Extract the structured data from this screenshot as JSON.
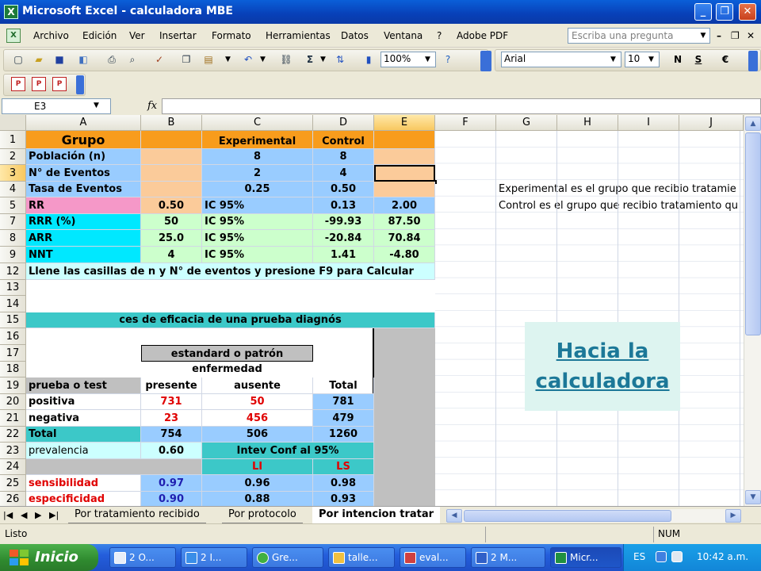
{
  "window": {
    "title": "Microsoft Excel - calculadora MBE",
    "minimize": "_",
    "maximize": "❐",
    "close": "✕"
  },
  "menu": {
    "items": [
      "Archivo",
      "Edición",
      "Ver",
      "Insertar",
      "Formato",
      "Herramientas",
      "Datos",
      "Ventana",
      "?",
      "Adobe PDF"
    ],
    "help_placeholder": "Escriba una pregunta",
    "mdi_minimize": "–",
    "mdi_restore": "❐",
    "mdi_close": "✕"
  },
  "toolbar": {
    "zoom": "100%",
    "font": "Arial",
    "font_size": "10",
    "bold": "N",
    "underline": "S",
    "currency": "€",
    "sum": "Σ"
  },
  "formula_bar": {
    "name_box": "E3",
    "fx": "fx",
    "content": ""
  },
  "columns": [
    "A",
    "B",
    "C",
    "D",
    "E",
    "F",
    "G",
    "H",
    "I",
    "J"
  ],
  "selected_column": "E",
  "rows": [
    "1",
    "2",
    "3",
    "4",
    "5",
    "7",
    "8",
    "9",
    "12",
    "13",
    "14",
    "15",
    "16",
    "17",
    "18",
    "19",
    "20",
    "21",
    "22",
    "23",
    "24",
    "25",
    "26"
  ],
  "selected_row": "3",
  "cells": {
    "r1": {
      "a": "Grupo",
      "c": "Experimental",
      "d": "Control"
    },
    "r2": {
      "a": "Población (n)",
      "c": "8",
      "d": "8"
    },
    "r3": {
      "a": "N° de Eventos",
      "c": "2",
      "d": "4"
    },
    "r4": {
      "a": "Tasa de Eventos",
      "c": "0.25",
      "d": "0.50"
    },
    "r5": {
      "a": "RR",
      "b": "0.50",
      "c": "IC 95%",
      "d": "0.13",
      "e": "2.00"
    },
    "r5_note": "Experimental es el grupo que recibio tratamie",
    "r7": {
      "a": "RRR (%)",
      "b": "50",
      "c": "IC 95%",
      "d": "-99.93",
      "e": "87.50"
    },
    "r7_note": "Control es el grupo que recibio tratamiento qu",
    "r8": {
      "a": "ARR",
      "b": "25.0",
      "c": "IC 95%",
      "d": "-20.84",
      "e": "70.84"
    },
    "r9": {
      "a": "NNT",
      "b": "4",
      "c": "IC 95%",
      "d": "1.41",
      "e": "-4.80"
    },
    "r12": {
      "a": "Llene las casillas de n y N° de eventos y presione F9 para Calcular"
    },
    "r15": {
      "a": "ces de eficacia de una prueba diagnós"
    },
    "r17": {
      "b": "estandard o patrón"
    },
    "r18": {
      "b": "enfermedad"
    },
    "r19": {
      "a": "prueba o test",
      "b": "presente",
      "c": "ausente",
      "d": "Total"
    },
    "r20": {
      "a": "positiva",
      "b": "731",
      "c": "50",
      "d": "781"
    },
    "r21": {
      "a": "negativa",
      "b": "23",
      "c": "456",
      "d": "479"
    },
    "r22": {
      "a": "Total",
      "b": "754",
      "c": "506",
      "d": "1260"
    },
    "r23": {
      "a": "prevalencia",
      "b": "0.60",
      "c": "Intev Conf al 95%"
    },
    "r24": {
      "c": "LI",
      "d": "LS"
    },
    "r25": {
      "a": "sensibilidad",
      "b": "0.97",
      "c": "0.96",
      "d": "0.98"
    },
    "r26": {
      "a": "especificidad",
      "b": "0.90",
      "c": "0.88",
      "d": "0.93"
    }
  },
  "hyperlink": {
    "line1": "Hacia la",
    "line2": "calculadora"
  },
  "sheet_tabs": [
    "Por tratamiento recibido",
    "Por protocolo",
    "Por intencion tratar"
  ],
  "active_tab": "Por intencion tratar",
  "status": {
    "text": "Listo",
    "num": "NUM"
  },
  "taskbar": {
    "start": "Inicio",
    "items": [
      "2 O...",
      "2 I...",
      "Gre...",
      "talle...",
      "eval...",
      "2 M...",
      "Micr..."
    ],
    "language": "ES",
    "clock": "10:42 a.m."
  },
  "colors": {
    "orange": "#f89c1c",
    "peach": "#fbcb9a",
    "blue": "#99ccff",
    "pink": "#f598c8",
    "cyan": "#00e8ff",
    "lightgreen": "#ccffcc",
    "teal": "#3cc8c8",
    "gray": "#c0c0c0",
    "lightcyan": "#ccffff"
  }
}
